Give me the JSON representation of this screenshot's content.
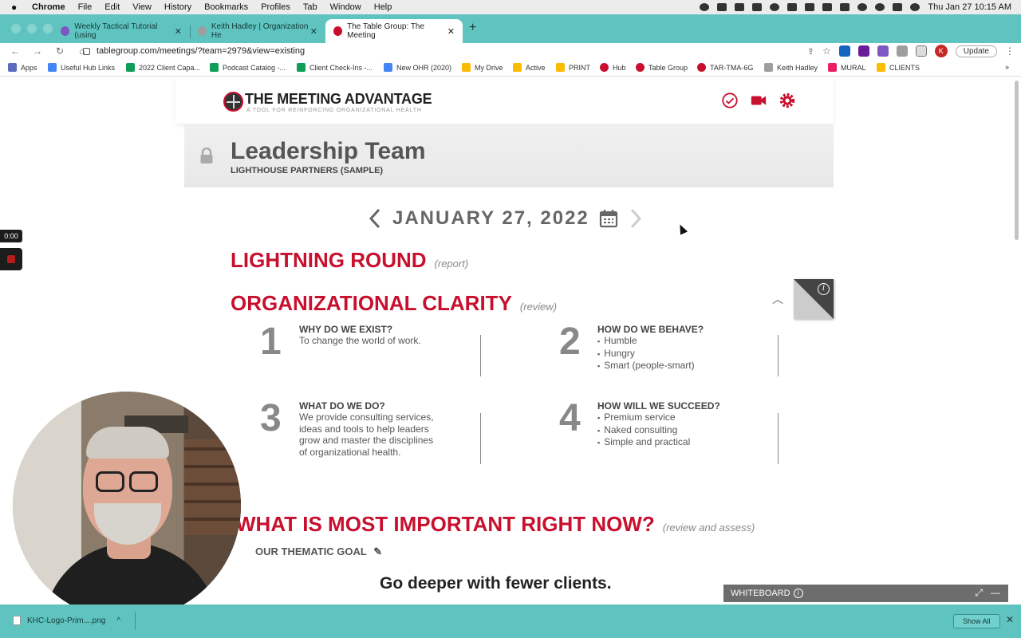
{
  "menubar": {
    "app": "Chrome",
    "items": [
      "File",
      "Edit",
      "View",
      "History",
      "Bookmarks",
      "Profiles",
      "Tab",
      "Window",
      "Help"
    ],
    "clock": "Thu Jan 27  10:15 AM"
  },
  "tabs": [
    {
      "title": "Weekly Tactical Tutorial (using",
      "active": false,
      "favicon_color": "#7e57c2"
    },
    {
      "title": "Keith Hadley | Organization He",
      "active": false,
      "favicon_color": "#9e9e9e"
    },
    {
      "title": "The Table Group: The Meeting",
      "active": true,
      "favicon_color": "#c8102e"
    }
  ],
  "address": {
    "url": "tablegroup.com/meetings/?team=2979&view=existing"
  },
  "toolbar": {
    "update_label": "Update",
    "profile_initial": "K"
  },
  "bookmarks": [
    {
      "label": "Apps",
      "color": "#5c6bc0"
    },
    {
      "label": "Useful Hub Links",
      "color": "#4285f4"
    },
    {
      "label": "2022 Client Capa...",
      "color": "#0f9d58"
    },
    {
      "label": "Podcast Catalog -...",
      "color": "#0f9d58"
    },
    {
      "label": "Client Check-Ins -...",
      "color": "#0f9d58"
    },
    {
      "label": "New OHR (2020)",
      "color": "#4285f4"
    },
    {
      "label": "My Drive",
      "color": "#fbbc04"
    },
    {
      "label": "Active",
      "color": "#fbbc04"
    },
    {
      "label": "PRINT",
      "color": "#fbbc04"
    },
    {
      "label": "Hub",
      "color": "#c8102e"
    },
    {
      "label": "Table Group",
      "color": "#c8102e"
    },
    {
      "label": "TAR-TMA-6G",
      "color": "#c8102e"
    },
    {
      "label": "Keith Hadley",
      "color": "#9e9e9e"
    },
    {
      "label": "MURAL",
      "color": "#e91e63"
    },
    {
      "label": "CLIENTS",
      "color": "#fbbc04"
    }
  ],
  "app": {
    "logo_title": "THE MEETING ADVANTAGE",
    "logo_subtitle": "A TOOL FOR REINFORCING ORGANIZATIONAL HEALTH",
    "accent": "#c8102e"
  },
  "team": {
    "name": "Leadership Team",
    "org": "LIGHTHOUSE PARTNERS (SAMPLE)"
  },
  "meeting": {
    "date": "JANUARY 27, 2022"
  },
  "sections": {
    "lightning": {
      "title": "LIGHTNING ROUND",
      "note": "(report)"
    },
    "clarity": {
      "title": "ORGANIZATIONAL CLARITY",
      "note": "(review)"
    },
    "important": {
      "title": "WHAT IS MOST IMPORTANT RIGHT NOW?",
      "note": "(review and assess)"
    }
  },
  "questions": [
    {
      "num": "1",
      "head": "WHY DO WE EXIST?",
      "text": "To change the world of work."
    },
    {
      "num": "2",
      "head": "HOW DO WE BEHAVE?",
      "items": [
        "Humble",
        "Hungry",
        "Smart (people-smart)"
      ]
    },
    {
      "num": "3",
      "head": "WHAT DO WE DO?",
      "text_lines": [
        "We provide consulting services,",
        "ideas and tools to help leaders",
        "grow and master the disciplines",
        "of organizational health."
      ]
    },
    {
      "num": "4",
      "head": "HOW WILL WE SUCCEED?",
      "items": [
        "Premium service",
        "Naked consulting",
        "Simple and practical"
      ]
    }
  ],
  "goal": {
    "label": "OUR THEMATIC GOAL",
    "text": "Go deeper with fewer clients."
  },
  "whiteboard": {
    "label": "WHITEBOARD"
  },
  "recorder": {
    "time": "0:00"
  },
  "downloads": {
    "file": "KHC-Logo-Prim....png",
    "show_all": "Show All"
  }
}
